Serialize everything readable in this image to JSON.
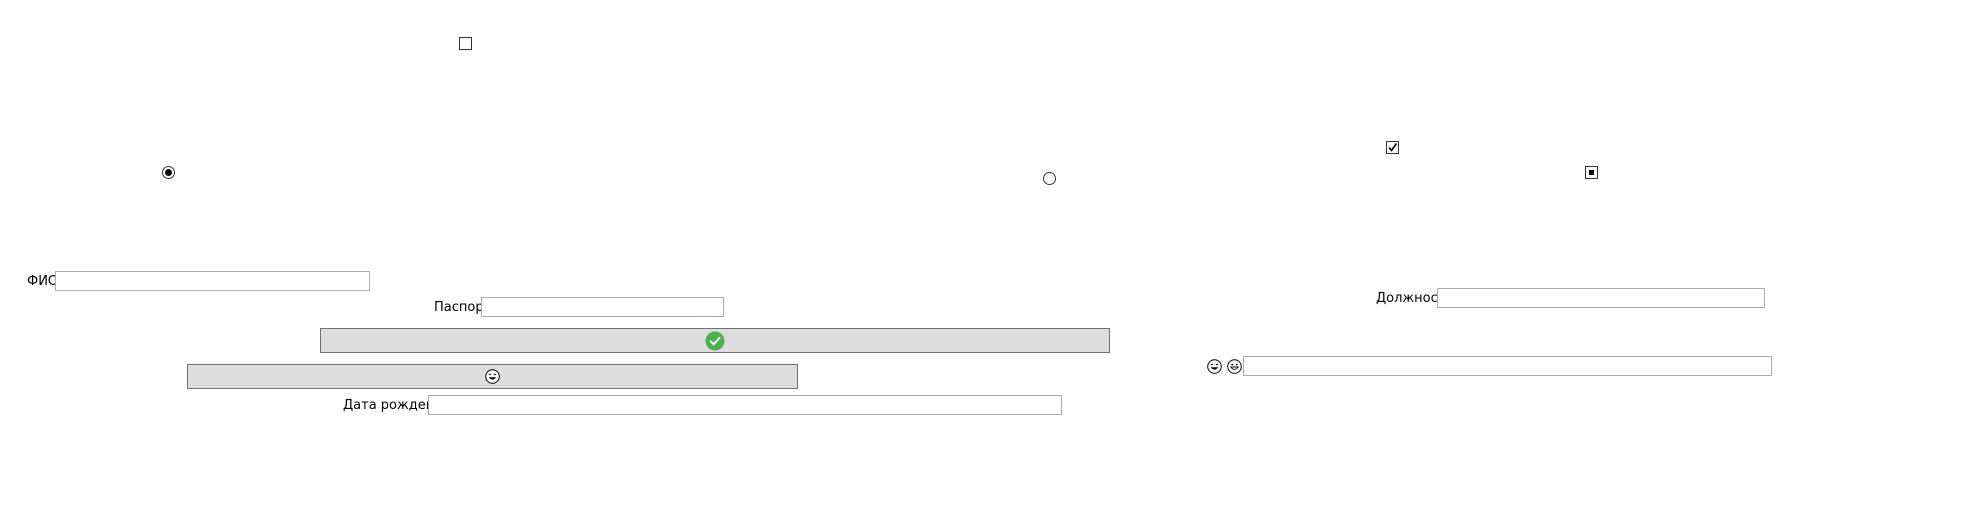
{
  "window": {
    "background": "#ffffff"
  },
  "controls": {
    "checkbox_top": {
      "checked": false
    },
    "checkbox_checked": {
      "checked": true
    },
    "checkbox_indeterminate": {
      "state": "indeterminate"
    },
    "radio_left": {
      "selected": true
    },
    "radio_right": {
      "selected": false
    }
  },
  "fields": {
    "fio": {
      "label": "ФИО",
      "value": ""
    },
    "passport": {
      "label": "Паспорт",
      "value": ""
    },
    "birthdate": {
      "label": "Дата рождения",
      "value": ""
    },
    "position": {
      "label": "Должность",
      "value": ""
    },
    "emoji_input": {
      "value": ""
    }
  },
  "buttons": {
    "confirm": {
      "icon": "check-circle-icon",
      "icon_color": "#4caf50"
    },
    "emoji": {
      "icon": "laughing-face-icon"
    }
  },
  "icons": {
    "emoji_a": "laughing-face-icon",
    "emoji_b": "grinning-face-icon"
  },
  "colors": {
    "button_bg": "#dddddd",
    "field_border": "#abadb3",
    "success": "#4caf50"
  }
}
